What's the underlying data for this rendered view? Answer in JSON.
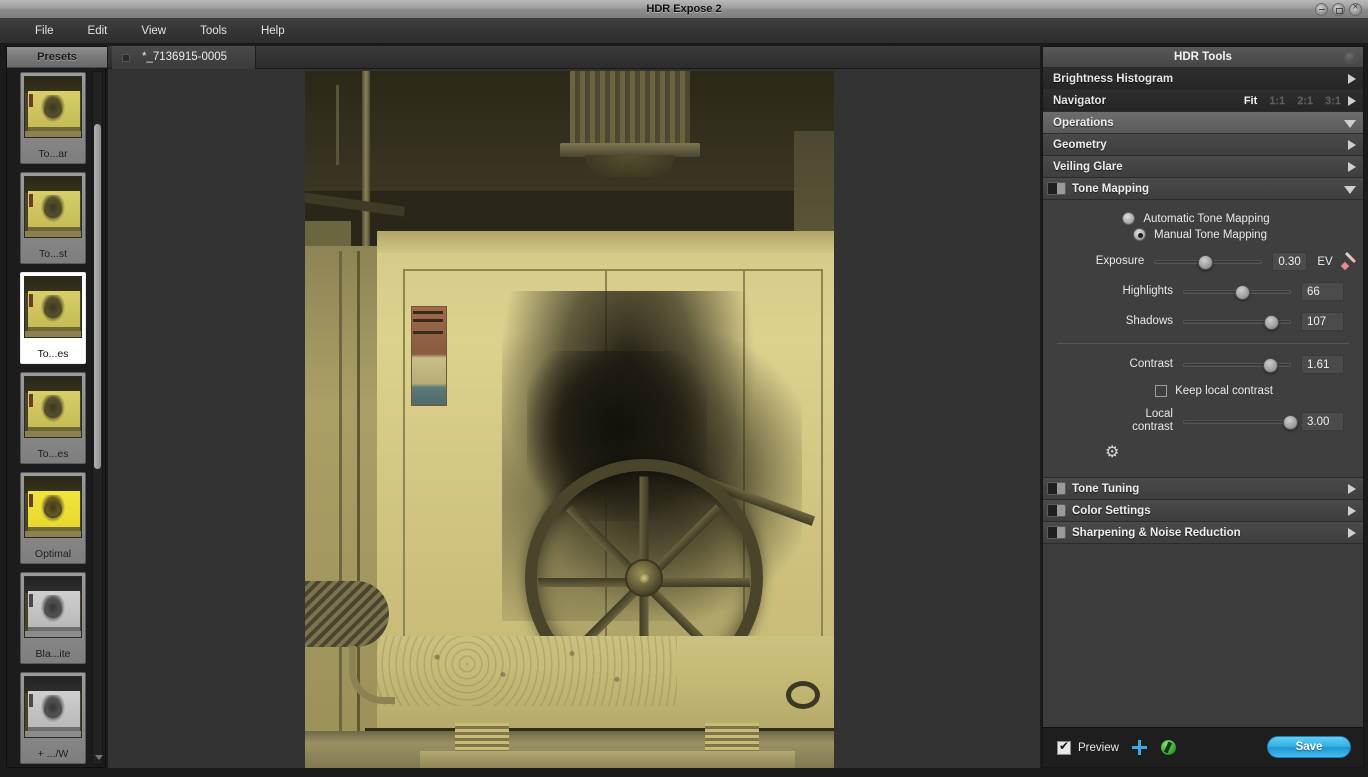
{
  "window": {
    "title": "HDR Expose 2",
    "controls": [
      "minimize",
      "maximize",
      "close"
    ]
  },
  "menubar": {
    "items": [
      {
        "label": "File"
      },
      {
        "label": "Edit"
      },
      {
        "label": "View"
      },
      {
        "label": "Tools"
      },
      {
        "label": "Help"
      }
    ]
  },
  "presets": {
    "header": "Presets",
    "items": [
      {
        "label": "To...ar",
        "style": "normal",
        "selected": false
      },
      {
        "label": "To...st",
        "style": "normal",
        "selected": false
      },
      {
        "label": "To...es",
        "style": "normal",
        "selected": true
      },
      {
        "label": "To...es",
        "style": "normal",
        "selected": false
      },
      {
        "label": "Optimal",
        "style": "bright",
        "selected": false
      },
      {
        "label": "Bla...ite",
        "style": "gray",
        "selected": false
      },
      {
        "label": "+ .../W",
        "style": "gray",
        "selected": false
      }
    ]
  },
  "document": {
    "tab_label": "*_7136915-0005"
  },
  "tools": {
    "header": "HDR Tools",
    "sections": [
      {
        "label": "Brightness Histogram",
        "expanded": false,
        "has_toggle": false,
        "shade": "dark"
      },
      {
        "label": "Navigator",
        "expanded": false,
        "has_toggle": false,
        "shade": "dark"
      },
      {
        "label": "Operations",
        "expanded": true,
        "has_toggle": false,
        "shade": "light"
      },
      {
        "label": "Geometry",
        "expanded": false,
        "has_toggle": false,
        "shade": "mid"
      },
      {
        "label": "Veiling Glare",
        "expanded": false,
        "has_toggle": false,
        "shade": "mid"
      },
      {
        "label": "Tone Mapping",
        "expanded": true,
        "has_toggle": true,
        "shade": "mid"
      },
      {
        "label": "Tone Tuning",
        "expanded": false,
        "has_toggle": true,
        "shade": "mid"
      },
      {
        "label": "Color Settings",
        "expanded": false,
        "has_toggle": true,
        "shade": "mid"
      },
      {
        "label": "Sharpening & Noise Reduction",
        "expanded": false,
        "has_toggle": true,
        "shade": "mid"
      }
    ],
    "navigator": {
      "zoom_levels": [
        {
          "label": "Fit",
          "active": true
        },
        {
          "label": "1:1",
          "active": false
        },
        {
          "label": "2:1",
          "active": false
        },
        {
          "label": "3:1",
          "active": false
        }
      ]
    },
    "tone_mapping": {
      "modes": [
        {
          "label": "Automatic Tone Mapping",
          "selected": false
        },
        {
          "label": "Manual Tone Mapping",
          "selected": true
        }
      ],
      "sliders": [
        {
          "name": "Exposure",
          "value": "0.30",
          "unit": "EV",
          "percent": 44,
          "has_eyedropper": true
        },
        {
          "name": "Highlights",
          "value": "66",
          "unit": "",
          "percent": 53,
          "has_eyedropper": false
        },
        {
          "name": "Shadows",
          "value": "107",
          "unit": "",
          "percent": 80,
          "has_eyedropper": false
        },
        {
          "name": "Contrast",
          "value": "1.61",
          "unit": "",
          "percent": 79,
          "has_eyedropper": false
        }
      ],
      "keep_local_contrast": {
        "label": "Keep local contrast",
        "checked": false
      },
      "local_contrast": {
        "name_line1": "Local",
        "name_line2": "contrast",
        "value": "3.00",
        "percent": 99
      },
      "advanced_icon": "gear-icon"
    }
  },
  "bottombar": {
    "preview_label": "Preview",
    "preview_checked": true,
    "add_icon": "plus-icon",
    "sync_icon": "sync-icon",
    "save_label": "Save"
  }
}
